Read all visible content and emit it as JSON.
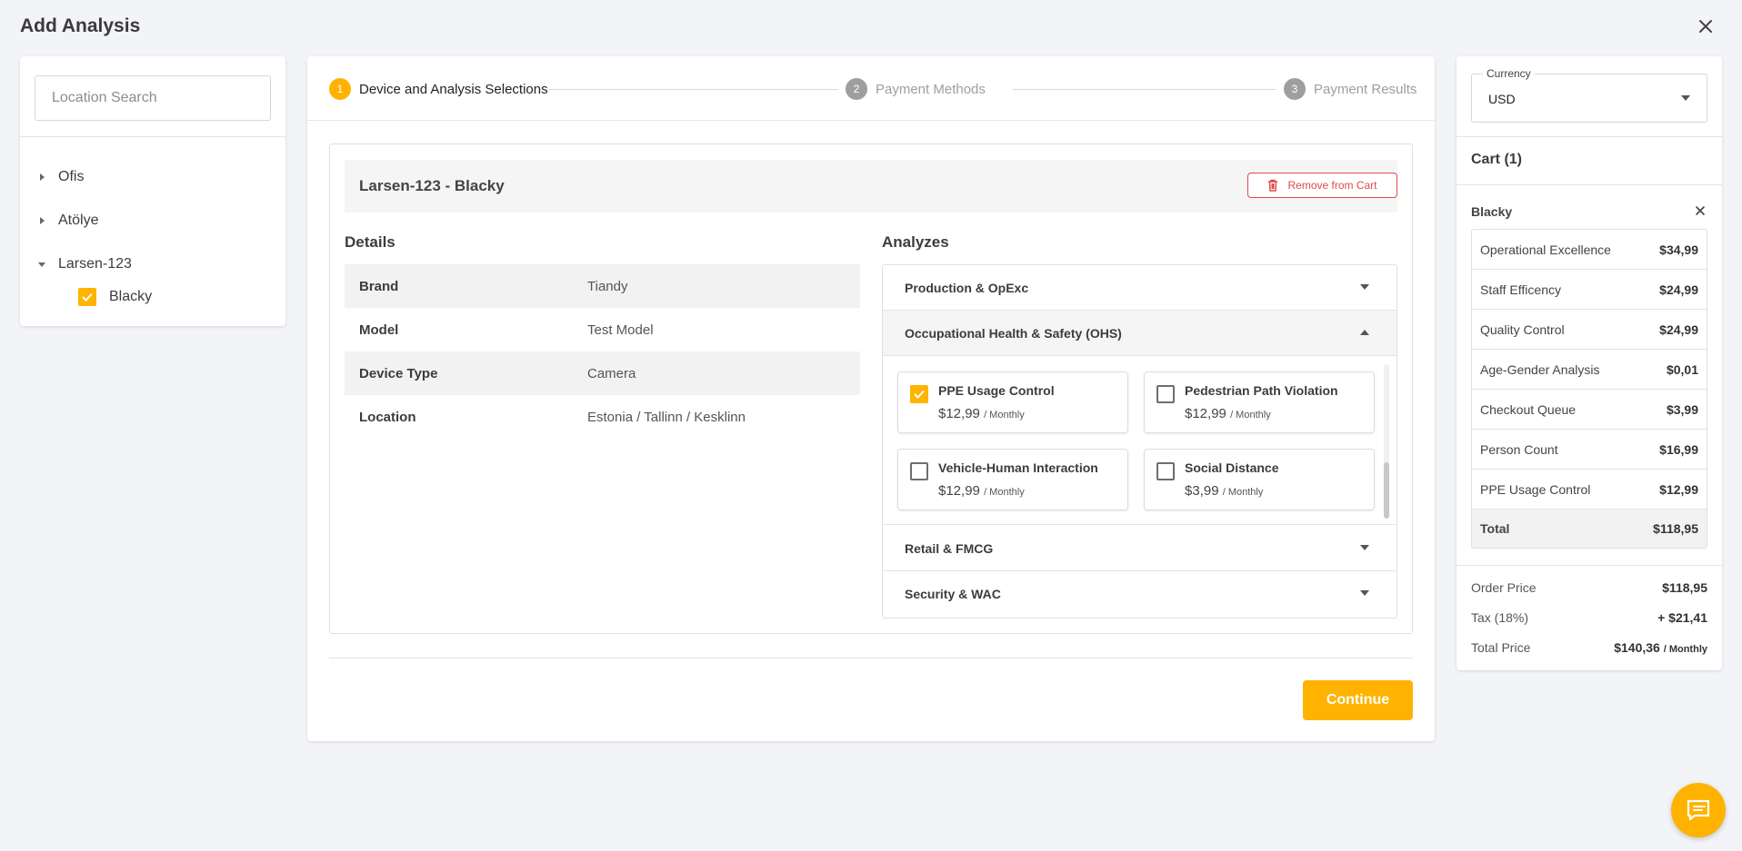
{
  "page_title": "Add Analysis",
  "left": {
    "search_placeholder": "Location Search",
    "tree": [
      {
        "label": "Ofis",
        "expanded": false
      },
      {
        "label": "Atölye",
        "expanded": false
      },
      {
        "label": "Larsen-123",
        "expanded": true
      }
    ],
    "child": {
      "label": "Blacky",
      "checked": true
    }
  },
  "stepper": {
    "steps": [
      {
        "num": "1",
        "label": "Device and Analysis Selections",
        "active": true
      },
      {
        "num": "2",
        "label": "Payment Methods",
        "active": false
      },
      {
        "num": "3",
        "label": "Payment Results",
        "active": false
      }
    ]
  },
  "device": {
    "title": "Larsen-123 - Blacky",
    "remove_label": "Remove from Cart",
    "details_title": "Details",
    "details": [
      {
        "key": "Brand",
        "value": "Tiandy"
      },
      {
        "key": "Model",
        "value": "Test Model"
      },
      {
        "key": "Device Type",
        "value": "Camera"
      },
      {
        "key": "Location",
        "value": "Estonia / Tallinn / Kesklinn"
      }
    ]
  },
  "analyzes": {
    "title": "Analyzes",
    "groups": [
      {
        "label": "Production & OpExc",
        "open": false
      },
      {
        "label": "Occupational Health & Safety (OHS)",
        "open": true
      },
      {
        "label": "Retail & FMCG",
        "open": false
      },
      {
        "label": "Security & WAC",
        "open": false
      }
    ],
    "options": [
      {
        "name": "PPE Usage Control",
        "price": "$12,99",
        "period": "/ Monthly",
        "checked": true
      },
      {
        "name": "Pedestrian Path Violation",
        "price": "$12,99",
        "period": "/ Monthly",
        "checked": false
      },
      {
        "name": "Vehicle-Human Interaction",
        "price": "$12,99",
        "period": "/ Monthly",
        "checked": false
      },
      {
        "name": "Social Distance",
        "price": "$3,99",
        "period": "/ Monthly",
        "checked": false
      }
    ]
  },
  "continue_label": "Continue",
  "cart": {
    "currency_label": "Currency",
    "currency_value": "USD",
    "title": "Cart (1)",
    "device_name": "Blacky",
    "items": [
      {
        "name": "Operational Excellence",
        "price": "$34,99"
      },
      {
        "name": "Staff Efficency",
        "price": "$24,99"
      },
      {
        "name": "Quality Control",
        "price": "$24,99"
      },
      {
        "name": "Age-Gender Analysis",
        "price": "$0,01"
      },
      {
        "name": "Checkout Queue",
        "price": "$3,99"
      },
      {
        "name": "Person Count",
        "price": "$16,99"
      },
      {
        "name": "PPE Usage Control",
        "price": "$12,99"
      }
    ],
    "total_label": "Total",
    "total_value": "$118,95",
    "order_price_label": "Order Price",
    "order_price": "$118,95",
    "tax_label": "Tax (18%)",
    "tax_value": "+ $21,41",
    "total_price_label": "Total Price",
    "total_price": "$140,36",
    "total_price_period": "/ Monthly"
  },
  "colors": {
    "accent": "#ffb300",
    "danger": "#e04a4a",
    "muted": "#9e9e9e"
  }
}
